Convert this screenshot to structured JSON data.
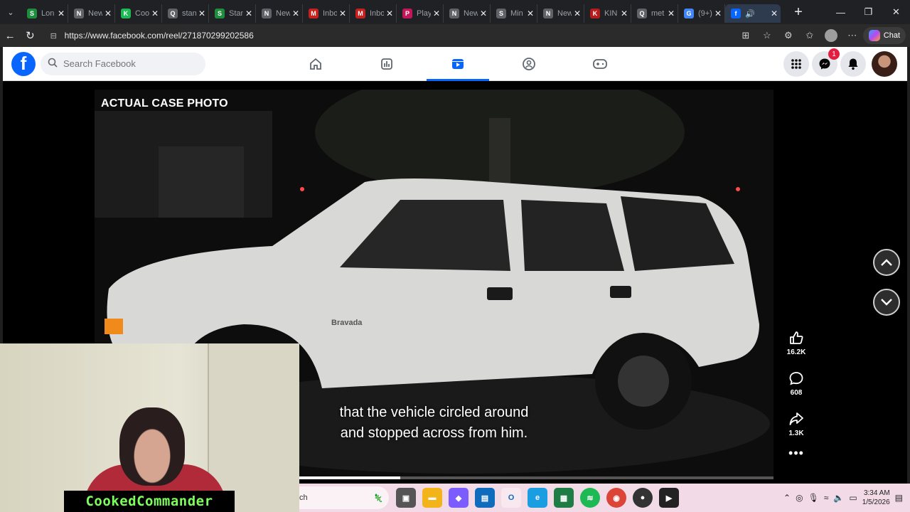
{
  "browser": {
    "tabs": [
      {
        "title": "Lon",
        "favicon": "S",
        "color": "#1e8e3e"
      },
      {
        "title": "New",
        "favicon": "N",
        "color": "#5f6368"
      },
      {
        "title": "Coo",
        "favicon": "K",
        "color": "#1db954"
      },
      {
        "title": "stan",
        "favicon": "Q",
        "color": "#5f6368"
      },
      {
        "title": "Stan",
        "favicon": "S",
        "color": "#1e8e3e"
      },
      {
        "title": "New",
        "favicon": "N",
        "color": "#5f6368"
      },
      {
        "title": "Inbo",
        "favicon": "M",
        "color": "#c5221f"
      },
      {
        "title": "Inbo",
        "favicon": "M",
        "color": "#c5221f"
      },
      {
        "title": "Play",
        "favicon": "P",
        "color": "#c2185b"
      },
      {
        "title": "New",
        "favicon": "N",
        "color": "#5f6368"
      },
      {
        "title": "Min",
        "favicon": "S",
        "color": "#5f6368"
      },
      {
        "title": "New",
        "favicon": "N",
        "color": "#5f6368"
      },
      {
        "title": "KIN",
        "favicon": "K",
        "color": "#b71c1c"
      },
      {
        "title": "met",
        "favicon": "Q",
        "color": "#5f6368"
      },
      {
        "title": "(9+)",
        "favicon": "G",
        "color": "#4285f4"
      }
    ],
    "active_tab_favicon": "f",
    "active_tab_color": "#0866ff",
    "url": "https://www.facebook.com/reel/271870299202586",
    "copilot_label": "Chat"
  },
  "facebook": {
    "search_placeholder": "Search Facebook",
    "nav": [
      "home-icon",
      "dashboard-icon",
      "video-icon",
      "groups-icon",
      "gaming-icon"
    ],
    "messenger_badge": "1",
    "brand_color": "#0866ff"
  },
  "reel": {
    "overlay_label": "ACTUAL CASE PHOTO",
    "vehicle_text": "Bravada",
    "subtitle_line1": "that the vehicle circled around",
    "subtitle_line2": "and stopped across from him.",
    "progress": 0.45,
    "likes": "16.2K",
    "comments": "608",
    "shares": "1.3K"
  },
  "webcam": {
    "streamer_name": "CookedCommander"
  },
  "taskbar": {
    "search_fragment": "ch",
    "time": "3:34 AM",
    "date": "1/5/2026"
  }
}
